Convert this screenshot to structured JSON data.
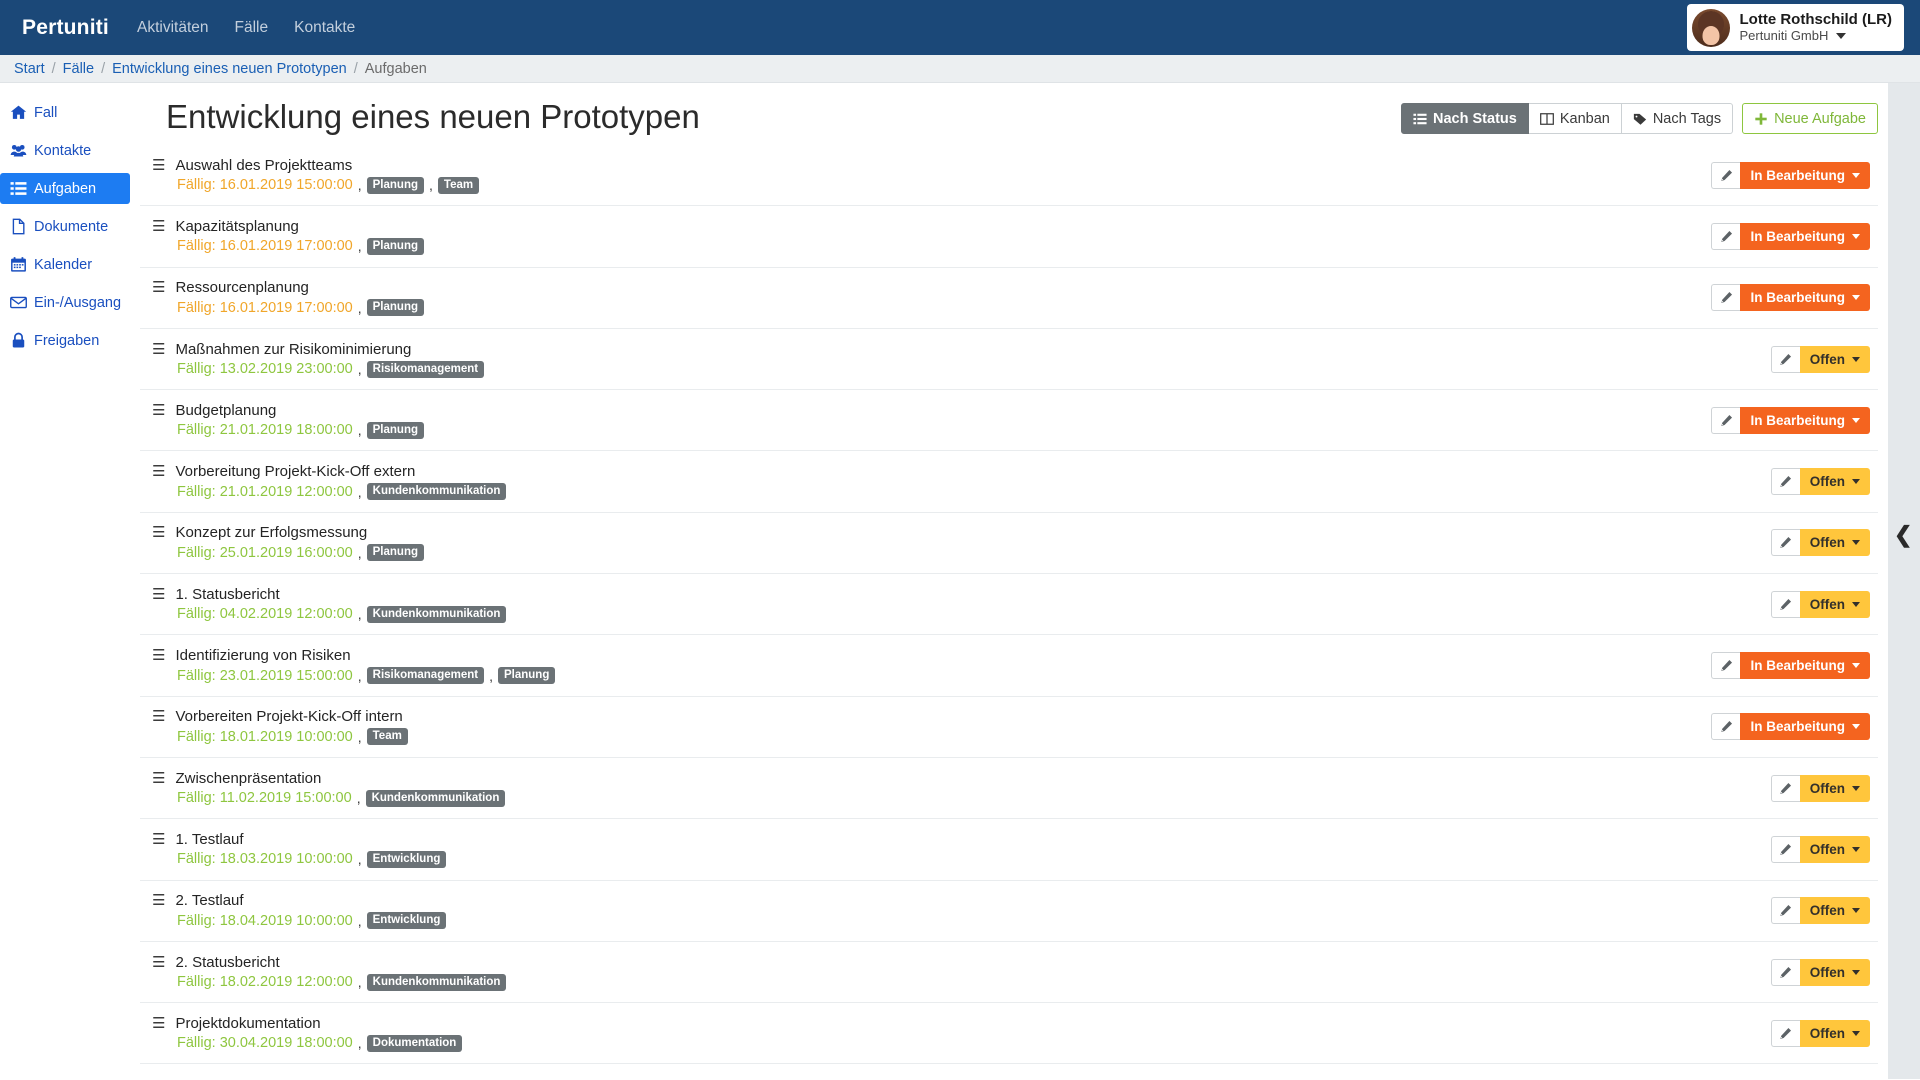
{
  "navbar": {
    "brand": "Pertuniti",
    "links": [
      "Aktivitäten",
      "Fälle",
      "Kontakte"
    ],
    "user": {
      "name": "Lotte Rothschild (LR)",
      "org": "Pertuniti GmbH",
      "avatar_icon": "user-avatar-photo",
      "caret_icon": "chevron-down-icon"
    }
  },
  "breadcrumb": {
    "items": [
      "Start",
      "Fälle",
      "Entwicklung eines neuen Prototypen",
      "Aufgaben"
    ],
    "separator": "/"
  },
  "sidebar": {
    "items": [
      {
        "label": "Fall",
        "icon": "home-icon",
        "active": false
      },
      {
        "label": "Kontakte",
        "icon": "users-icon",
        "active": false
      },
      {
        "label": "Aufgaben",
        "icon": "list-icon",
        "active": true
      },
      {
        "label": "Dokumente",
        "icon": "file-icon",
        "active": false
      },
      {
        "label": "Kalender",
        "icon": "calendar-icon",
        "active": false
      },
      {
        "label": "Ein-/Ausgang",
        "icon": "envelope-icon",
        "active": false
      },
      {
        "label": "Freigaben",
        "icon": "lock-icon",
        "active": false
      }
    ]
  },
  "page": {
    "title": "Entwicklung eines neuen Prototypen",
    "toolbar": {
      "views": [
        {
          "label": "Nach Status",
          "icon": "list-icon",
          "active": true
        },
        {
          "label": "Kanban",
          "icon": "columns-icon",
          "active": false
        },
        {
          "label": "Nach Tags",
          "icon": "tag-icon",
          "active": false
        }
      ],
      "new_task_label": "Neue Aufgabe",
      "new_task_icon": "plus-icon"
    }
  },
  "labels": {
    "due_prefix": "Fällig:",
    "comma": ",",
    "drag_handle_icon": "drag-handle-icon",
    "edit_icon": "pencil-icon",
    "rail_toggle_icon": "chevron-left-icon"
  },
  "colors": {
    "navbar": "#1b4878",
    "active_sidebar": "#1d7cf2",
    "link": "#1a4fbf",
    "overdue": "#f0a62a",
    "ontime": "#8ec63f",
    "status_inprogress": "#f4641f",
    "status_open": "#ffc63c",
    "tag": "#6b7276",
    "new_button": "#8ec63f"
  },
  "tasks": [
    {
      "title": "Auswahl des Projektteams",
      "due": "16.01.2019 15:00:00",
      "due_state": "overdue",
      "tags": [
        "Planung",
        "Team"
      ],
      "status": "In Bearbeitung",
      "status_state": "inprogress"
    },
    {
      "title": "Kapazitätsplanung",
      "due": "16.01.2019 17:00:00",
      "due_state": "overdue",
      "tags": [
        "Planung"
      ],
      "status": "In Bearbeitung",
      "status_state": "inprogress"
    },
    {
      "title": "Ressourcenplanung",
      "due": "16.01.2019 17:00:00",
      "due_state": "overdue",
      "tags": [
        "Planung"
      ],
      "status": "In Bearbeitung",
      "status_state": "inprogress"
    },
    {
      "title": "Maßnahmen zur Risikominimierung",
      "due": "13.02.2019 23:00:00",
      "due_state": "ok",
      "tags": [
        "Risikomanagement"
      ],
      "status": "Offen",
      "status_state": "open"
    },
    {
      "title": "Budgetplanung",
      "due": "21.01.2019 18:00:00",
      "due_state": "ok",
      "tags": [
        "Planung"
      ],
      "status": "In Bearbeitung",
      "status_state": "inprogress"
    },
    {
      "title": "Vorbereitung Projekt-Kick-Off extern",
      "due": "21.01.2019 12:00:00",
      "due_state": "ok",
      "tags": [
        "Kundenkommunikation"
      ],
      "status": "Offen",
      "status_state": "open"
    },
    {
      "title": "Konzept zur Erfolgsmessung",
      "due": "25.01.2019 16:00:00",
      "due_state": "ok",
      "tags": [
        "Planung"
      ],
      "status": "Offen",
      "status_state": "open"
    },
    {
      "title": "1. Statusbericht",
      "due": "04.02.2019 12:00:00",
      "due_state": "ok",
      "tags": [
        "Kundenkommunikation"
      ],
      "status": "Offen",
      "status_state": "open"
    },
    {
      "title": "Identifizierung von Risiken",
      "due": "23.01.2019 15:00:00",
      "due_state": "ok",
      "tags": [
        "Risikomanagement",
        "Planung"
      ],
      "status": "In Bearbeitung",
      "status_state": "inprogress"
    },
    {
      "title": "Vorbereiten Projekt-Kick-Off intern",
      "due": "18.01.2019 10:00:00",
      "due_state": "ok",
      "tags": [
        "Team"
      ],
      "status": "In Bearbeitung",
      "status_state": "inprogress"
    },
    {
      "title": "Zwischenpräsentation",
      "due": "11.02.2019 15:00:00",
      "due_state": "ok",
      "tags": [
        "Kundenkommunikation"
      ],
      "status": "Offen",
      "status_state": "open"
    },
    {
      "title": "1. Testlauf",
      "due": "18.03.2019 10:00:00",
      "due_state": "ok",
      "tags": [
        "Entwicklung"
      ],
      "status": "Offen",
      "status_state": "open"
    },
    {
      "title": "2. Testlauf",
      "due": "18.04.2019 10:00:00",
      "due_state": "ok",
      "tags": [
        "Entwicklung"
      ],
      "status": "Offen",
      "status_state": "open"
    },
    {
      "title": "2. Statusbericht",
      "due": "18.02.2019 12:00:00",
      "due_state": "ok",
      "tags": [
        "Kundenkommunikation"
      ],
      "status": "Offen",
      "status_state": "open"
    },
    {
      "title": "Projektdokumentation",
      "due": "30.04.2019 18:00:00",
      "due_state": "ok",
      "tags": [
        "Dokumentation"
      ],
      "status": "Offen",
      "status_state": "open"
    }
  ]
}
